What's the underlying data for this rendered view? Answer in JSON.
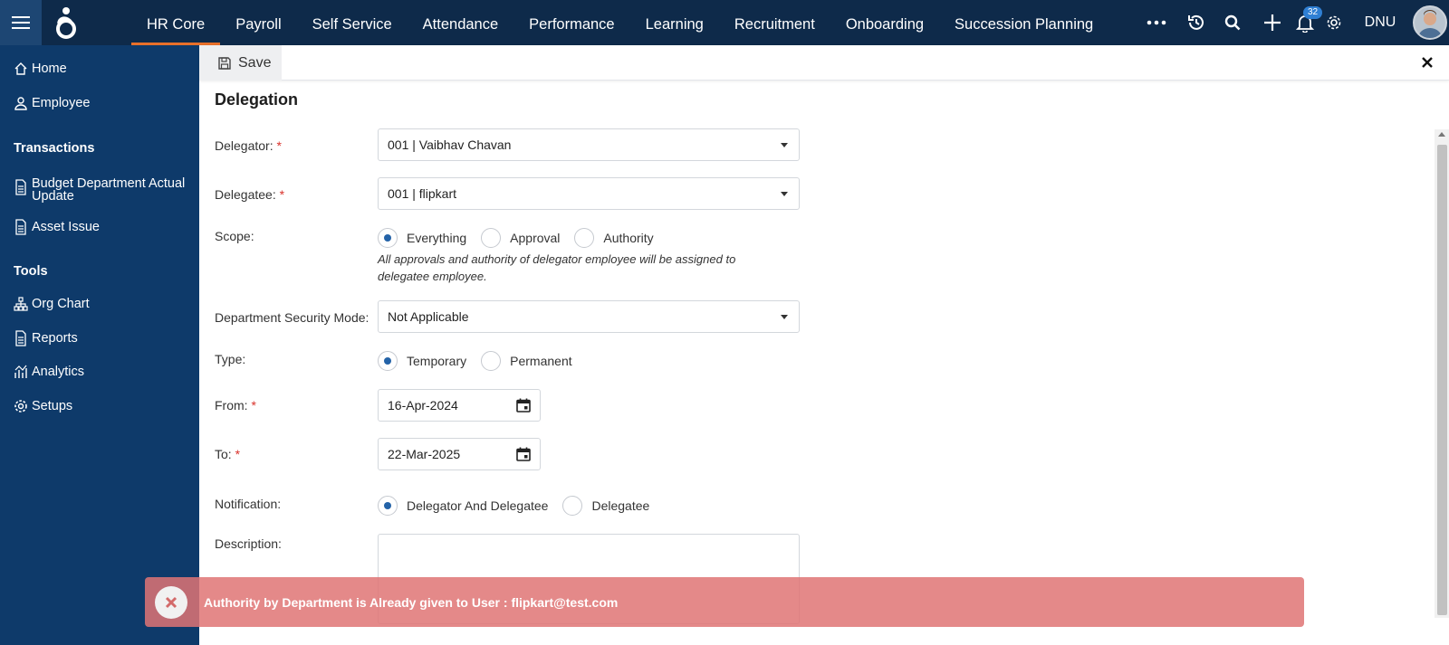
{
  "topbar": {
    "nav": [
      "HR Core",
      "Payroll",
      "Self Service",
      "Attendance",
      "Performance",
      "Learning",
      "Recruitment",
      "Onboarding",
      "Succession Planning"
    ],
    "active_nav": "HR Core",
    "notification_count": "32",
    "user_initials": "DNU",
    "icons": [
      "menu-icon",
      "app-logo",
      "more-icon",
      "history-icon",
      "search-icon",
      "add-icon",
      "bell-icon",
      "gear-icon",
      "avatar"
    ]
  },
  "sidebar": {
    "items": [
      {
        "label": "Home",
        "icon": "home-icon"
      },
      {
        "label": "Employee",
        "icon": "employee-icon"
      }
    ],
    "transactions_title": "Transactions",
    "transactions": [
      {
        "label": "Budget Department Actual Update",
        "line1": "Budget Department Actual",
        "line2": "Update",
        "icon": "document-icon"
      },
      {
        "label": "Asset Issue",
        "icon": "document-icon"
      }
    ],
    "tools_title": "Tools",
    "tools": [
      {
        "label": "Org Chart",
        "icon": "org-chart-icon"
      },
      {
        "label": "Reports",
        "icon": "document-icon"
      },
      {
        "label": "Analytics",
        "icon": "analytics-icon"
      },
      {
        "label": "Setups",
        "icon": "gear-icon"
      }
    ]
  },
  "toolbar": {
    "save_label": "Save"
  },
  "form": {
    "title": "Delegation",
    "delegator_label": "Delegator:",
    "delegator_value": "001 | Vaibhav Chavan",
    "delegatee_label": "Delegatee:",
    "delegatee_value": "001 | flipkart",
    "scope_label": "Scope:",
    "scope_options": [
      "Everything",
      "Approval",
      "Authority"
    ],
    "scope_selected": "Everything",
    "scope_hint": "All approvals and authority of delegator employee will be assigned to delegatee employee.",
    "dept_security_label": "Department Security Mode:",
    "dept_security_value": "Not Applicable",
    "type_label": "Type:",
    "type_options": [
      "Temporary",
      "Permanent"
    ],
    "type_selected": "Temporary",
    "from_label": "From:",
    "from_value": "16-Apr-2024",
    "to_label": "To:",
    "to_value": "22-Mar-2025",
    "notification_label": "Notification:",
    "notification_options": [
      "Delegator And Delegatee",
      "Delegatee"
    ],
    "notification_selected": "Delegator And Delegatee",
    "description_label": "Description:",
    "description_value": "",
    "required_marker": "*"
  },
  "toast": {
    "message": "Authority by Department is Already given to User : flipkart@test.com"
  },
  "colors": {
    "topbar_bg": "#0e2a4a",
    "sidebar_bg": "#0e3a6a",
    "active_underline": "#e8702a",
    "radio_checked": "#2463a8",
    "toast_bg": "#df7474",
    "badge_bg": "#2f7fd3"
  }
}
